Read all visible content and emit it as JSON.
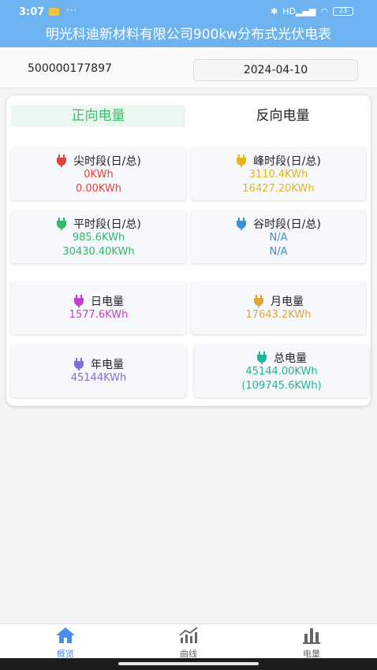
{
  "status_bar": {
    "time": "3:07",
    "dots": "···",
    "network": "HD",
    "battery": "23"
  },
  "app": {
    "title": "明光科迪新材料有限公司900kw分布式光伏电表"
  },
  "info": {
    "meter_id": "500000177897",
    "date": "2024-04-10"
  },
  "tabs": [
    {
      "label": "正向电量",
      "active": true
    },
    {
      "label": "反向电量",
      "active": false
    }
  ],
  "cards": {
    "peak_sharp": {
      "title": "尖时段(日/总)",
      "day": "0KWh",
      "total": "0.00KWh",
      "color": "#e0443c"
    },
    "peak": {
      "title": "峰时段(日/总)",
      "day": "3110.4KWh",
      "total": "16427.20KWh",
      "color": "#e6b51c"
    },
    "flat": {
      "title": "平时段(日/总)",
      "day": "985.6KWh",
      "total": "30430.40KWh",
      "color": "#2fb86a"
    },
    "valley": {
      "title": "谷时段(日/总)",
      "day": "N/A",
      "total": "N/A",
      "color": "#3a90d8"
    },
    "daily": {
      "title": "日电量",
      "value": "1577.6KWh",
      "color": "#c23fd0"
    },
    "monthly": {
      "title": "月电量",
      "value": "17643.2KWh",
      "color": "#e0a53a"
    },
    "yearly": {
      "title": "年电量",
      "value": "45144KWh",
      "color": "#7e6fd6"
    },
    "total": {
      "title": "总电量",
      "value": "45144.00KWh",
      "value2": "(109745.6KWh)",
      "color": "#1fb59a"
    }
  },
  "nav": [
    {
      "label": "概览",
      "icon": "home-icon",
      "active": true
    },
    {
      "label": "曲线",
      "icon": "line-chart-icon",
      "active": false
    },
    {
      "label": "电量",
      "icon": "bar-chart-icon",
      "active": false
    }
  ]
}
